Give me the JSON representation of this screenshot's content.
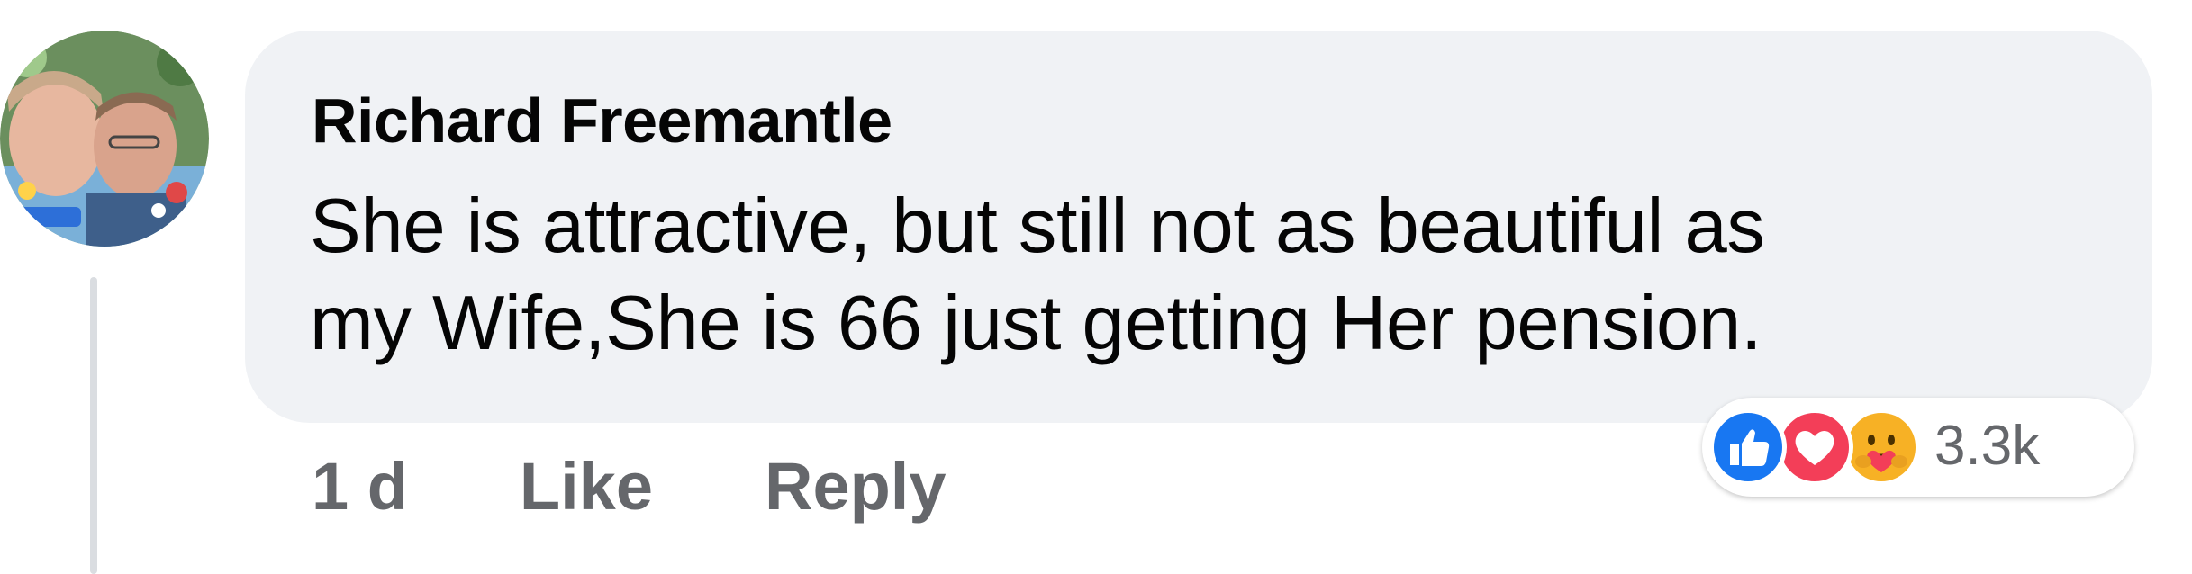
{
  "comment": {
    "author": "Richard Freemantle",
    "text_lines": [
      "She is attractive, but still not as beautiful as",
      "my Wife,She is 66 just getting Her pension."
    ]
  },
  "actions": {
    "time": "1 d",
    "like_label": "Like",
    "reply_label": "Reply"
  },
  "reactions": {
    "icons": [
      "like-icon",
      "love-icon",
      "care-icon"
    ],
    "count": "3.3k"
  },
  "colors": {
    "bubble": "#f0f2f5",
    "text": "#050505",
    "secondary_text": "#65676b",
    "like": "#1877f2",
    "love": "#f33e58",
    "care": "#f7b125",
    "thread_line": "#dadde1"
  }
}
